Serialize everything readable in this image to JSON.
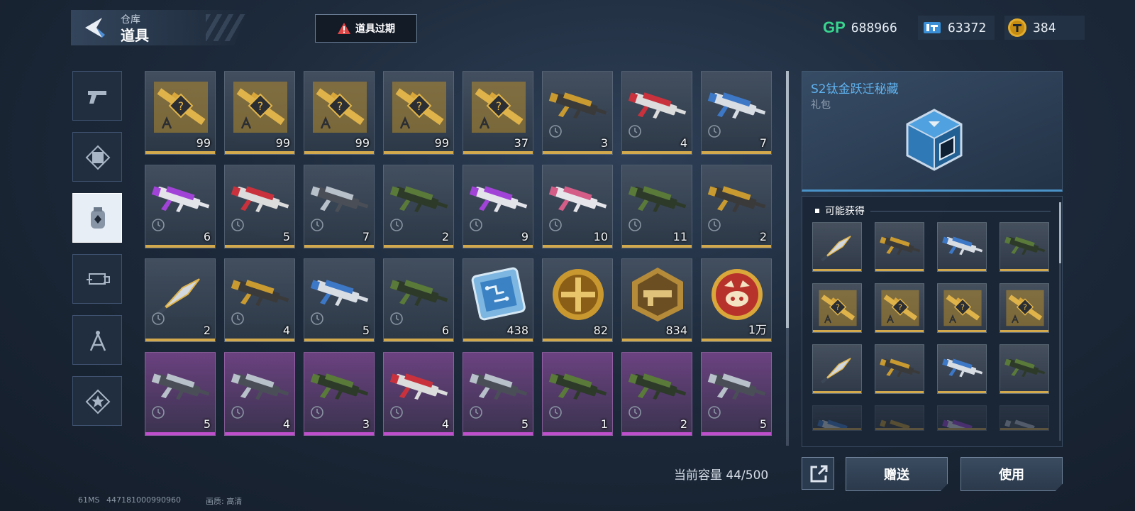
{
  "header": {
    "breadcrumb_parent": "仓库",
    "title": "道具",
    "expire_button_label": "道具过期"
  },
  "currencies": [
    {
      "icon": "gp-icon",
      "label": "GP",
      "value": "688966"
    },
    {
      "icon": "ticket-icon",
      "value": "63372"
    },
    {
      "icon": "gold-coin-icon",
      "value": "384"
    }
  ],
  "sidebar": {
    "items": [
      {
        "name": "weapons",
        "icon": "pistol-icon",
        "active": false
      },
      {
        "name": "character",
        "icon": "frame-icon",
        "active": false
      },
      {
        "name": "items",
        "icon": "item-bag-icon",
        "active": true
      },
      {
        "name": "accessories",
        "icon": "attachment-icon",
        "active": false
      },
      {
        "name": "blueprints",
        "icon": "compass-icon",
        "active": false
      },
      {
        "name": "badges",
        "icon": "star-badge-icon",
        "active": false
      }
    ]
  },
  "inventory": {
    "items": [
      {
        "kind": "blueprint-gun",
        "qty": "99",
        "rarity": "gold"
      },
      {
        "kind": "blueprint-gun",
        "qty": "99",
        "rarity": "gold"
      },
      {
        "kind": "blueprint-gun",
        "qty": "99",
        "rarity": "gold"
      },
      {
        "kind": "blueprint-gun",
        "qty": "99",
        "rarity": "gold"
      },
      {
        "kind": "blueprint-gun",
        "qty": "37",
        "rarity": "gold"
      },
      {
        "kind": "gun-gold",
        "qty": "3",
        "rarity": "gold"
      },
      {
        "kind": "gun-red",
        "qty": "4",
        "rarity": "gold"
      },
      {
        "kind": "gun-blue",
        "qty": "7",
        "rarity": "gold"
      },
      {
        "kind": "gun-purple",
        "qty": "6",
        "rarity": "gold"
      },
      {
        "kind": "gun-red",
        "qty": "5",
        "rarity": "gold"
      },
      {
        "kind": "gun-silver",
        "qty": "7",
        "rarity": "gold"
      },
      {
        "kind": "gun-green",
        "qty": "2",
        "rarity": "gold"
      },
      {
        "kind": "gun-purple",
        "qty": "9",
        "rarity": "gold"
      },
      {
        "kind": "gun-pink",
        "qty": "10",
        "rarity": "gold"
      },
      {
        "kind": "gun-green",
        "qty": "11",
        "rarity": "gold"
      },
      {
        "kind": "gun-gold",
        "qty": "2",
        "rarity": "gold"
      },
      {
        "kind": "knife",
        "qty": "2",
        "rarity": "gold"
      },
      {
        "kind": "gun-gold",
        "qty": "4",
        "rarity": "gold"
      },
      {
        "kind": "gun-blue",
        "qty": "5",
        "rarity": "gold"
      },
      {
        "kind": "gun-green",
        "qty": "6",
        "rarity": "gold"
      },
      {
        "kind": "chip",
        "qty": "438",
        "rarity": "gold"
      },
      {
        "kind": "medal-cross",
        "qty": "82",
        "rarity": "gold"
      },
      {
        "kind": "medal-hex",
        "qty": "834",
        "rarity": "gold"
      },
      {
        "kind": "medal-pig",
        "qty": "1万",
        "rarity": "gold"
      },
      {
        "kind": "gun-silver",
        "qty": "5",
        "rarity": "purple"
      },
      {
        "kind": "gun-silver",
        "qty": "4",
        "rarity": "purple"
      },
      {
        "kind": "gun-green",
        "qty": "3",
        "rarity": "purple"
      },
      {
        "kind": "gun-red",
        "qty": "4",
        "rarity": "purple"
      },
      {
        "kind": "gun-silver",
        "qty": "5",
        "rarity": "purple"
      },
      {
        "kind": "gun-green",
        "qty": "1",
        "rarity": "purple"
      },
      {
        "kind": "gun-green",
        "qty": "2",
        "rarity": "purple"
      },
      {
        "kind": "gun-silver",
        "qty": "5",
        "rarity": "purple"
      }
    ],
    "capacity_label": "当前容量 44/500"
  },
  "detail": {
    "title": "S2钛金跃迁秘藏",
    "subtitle": "礼包",
    "icon": "cube-crate-icon"
  },
  "rewards": {
    "title": "可能获得",
    "items": [
      {
        "kind": "knife"
      },
      {
        "kind": "gun-gold"
      },
      {
        "kind": "gun-blue"
      },
      {
        "kind": "gun-green"
      },
      {
        "kind": "blueprint-knife"
      },
      {
        "kind": "blueprint-gun"
      },
      {
        "kind": "blueprint-gun"
      },
      {
        "kind": "blueprint-gun"
      },
      {
        "kind": "knife"
      },
      {
        "kind": "gun-gold"
      },
      {
        "kind": "gun-blue"
      },
      {
        "kind": "gun-green"
      },
      {
        "kind": "gun-blue"
      },
      {
        "kind": "gun-gold"
      },
      {
        "kind": "gun-purple"
      },
      {
        "kind": "gun-silver"
      }
    ]
  },
  "actions": {
    "share_icon": "share-out-icon",
    "gift_label": "赠送",
    "use_label": "使用"
  },
  "footer": {
    "ping": "61MS",
    "player_id": "447181000990960",
    "quality": "画质: 高清"
  },
  "colors": {
    "accent_blue": "#5fb2ef",
    "gold_bar": "#d3a94d",
    "purple_bar": "#c04fcd",
    "gp_green": "#39d58f"
  }
}
